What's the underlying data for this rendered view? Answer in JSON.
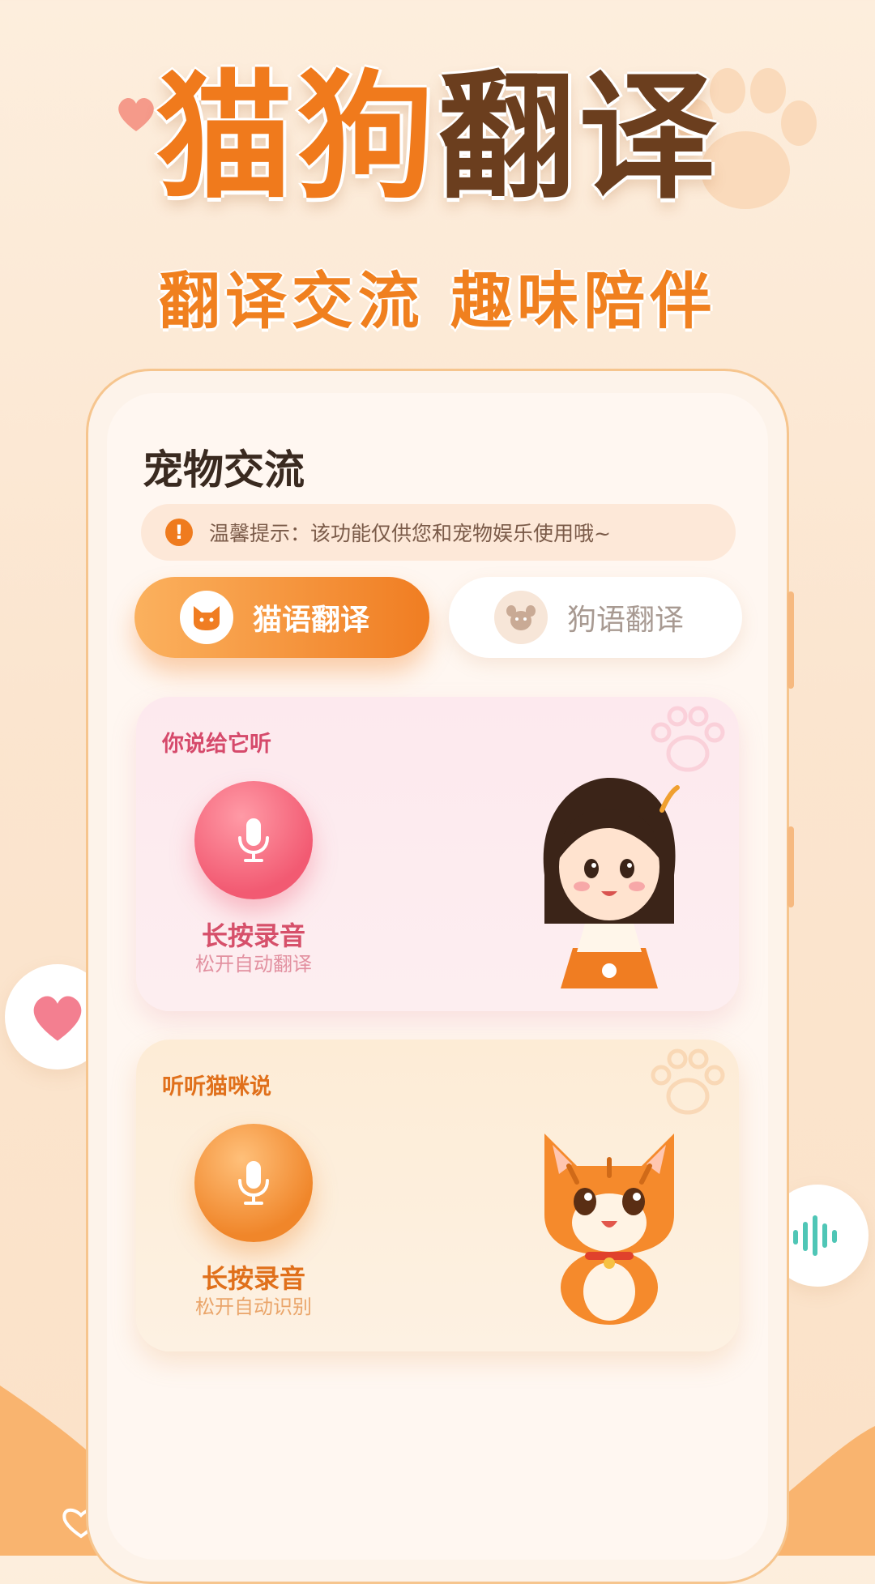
{
  "hero": {
    "title_part1": "猫狗",
    "title_part2": "翻译",
    "subtitle": "翻译交流 趣味陪伴"
  },
  "page": {
    "title": "宠物交流"
  },
  "notice": {
    "icon": "exclamation-icon",
    "text": "温馨提示：该功能仅供您和宠物娱乐使用哦~"
  },
  "tabs": [
    {
      "label": "猫语翻译",
      "icon": "cat-face-icon",
      "active": true
    },
    {
      "label": "狗语翻译",
      "icon": "dog-face-icon",
      "active": false
    }
  ],
  "cards": [
    {
      "heading": "你说给它听",
      "mic_label": "长按录音",
      "mic_sub": "松开自动翻译",
      "illustration": "girl-avatar"
    },
    {
      "heading": "听听猫咪说",
      "mic_label": "长按录音",
      "mic_sub": "松开自动识别",
      "illustration": "cat-avatar"
    }
  ],
  "colors": {
    "accent_orange": "#f07d22",
    "brown": "#6b3e1e",
    "pink": "#f25a72",
    "background": "#fdeedd"
  }
}
